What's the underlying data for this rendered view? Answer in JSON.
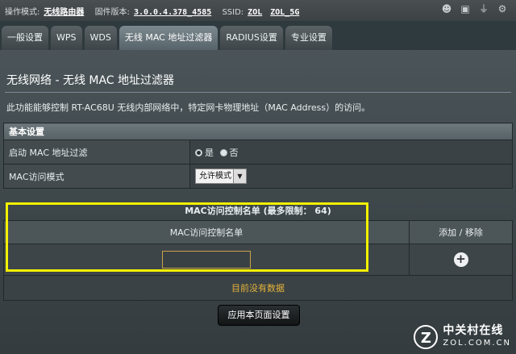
{
  "status": {
    "mode_label": "操作模式:",
    "mode_value": "无线路由器",
    "firmware_label": "固件版本:",
    "firmware_value": "3.0.0.4.378_4585",
    "ssid_label": "SSID:",
    "ssid_1": "ZOL",
    "ssid_2": "ZOL_5G",
    "icons": [
      "users-icon",
      "devices-icon",
      "usb-icon",
      "settings-icon"
    ]
  },
  "tabs": [
    "一般设置",
    "WPS",
    "WDS",
    "无线 MAC 地址过滤器",
    "RADIUS设置",
    "专业设置"
  ],
  "active_tab": 3,
  "page": {
    "title": "无线网络 - 无线 MAC 地址过滤器",
    "description": "此功能能够控制 RT-AC68U 无线内部网络中，特定网卡物理地址（MAC Address）的访问。"
  },
  "basic": {
    "header": "基本设置",
    "enable_label": "启动 MAC 地址过滤",
    "radio_yes": "是",
    "radio_no": "否",
    "enable_value": "是",
    "mode_label": "MAC访问模式",
    "mode_value": "允许模式"
  },
  "maclist": {
    "header": "MAC访问控制名单 (最多限制： 64)",
    "col_name": "MAC访问控制名单",
    "col_action": "添加 / 移除",
    "input_value": "",
    "empty_text": "目前没有数据"
  },
  "apply_label": "应用本页面设置",
  "watermark": {
    "logo": "Z",
    "main": "中关村在线",
    "sub": "ZOL.COM.CN"
  }
}
